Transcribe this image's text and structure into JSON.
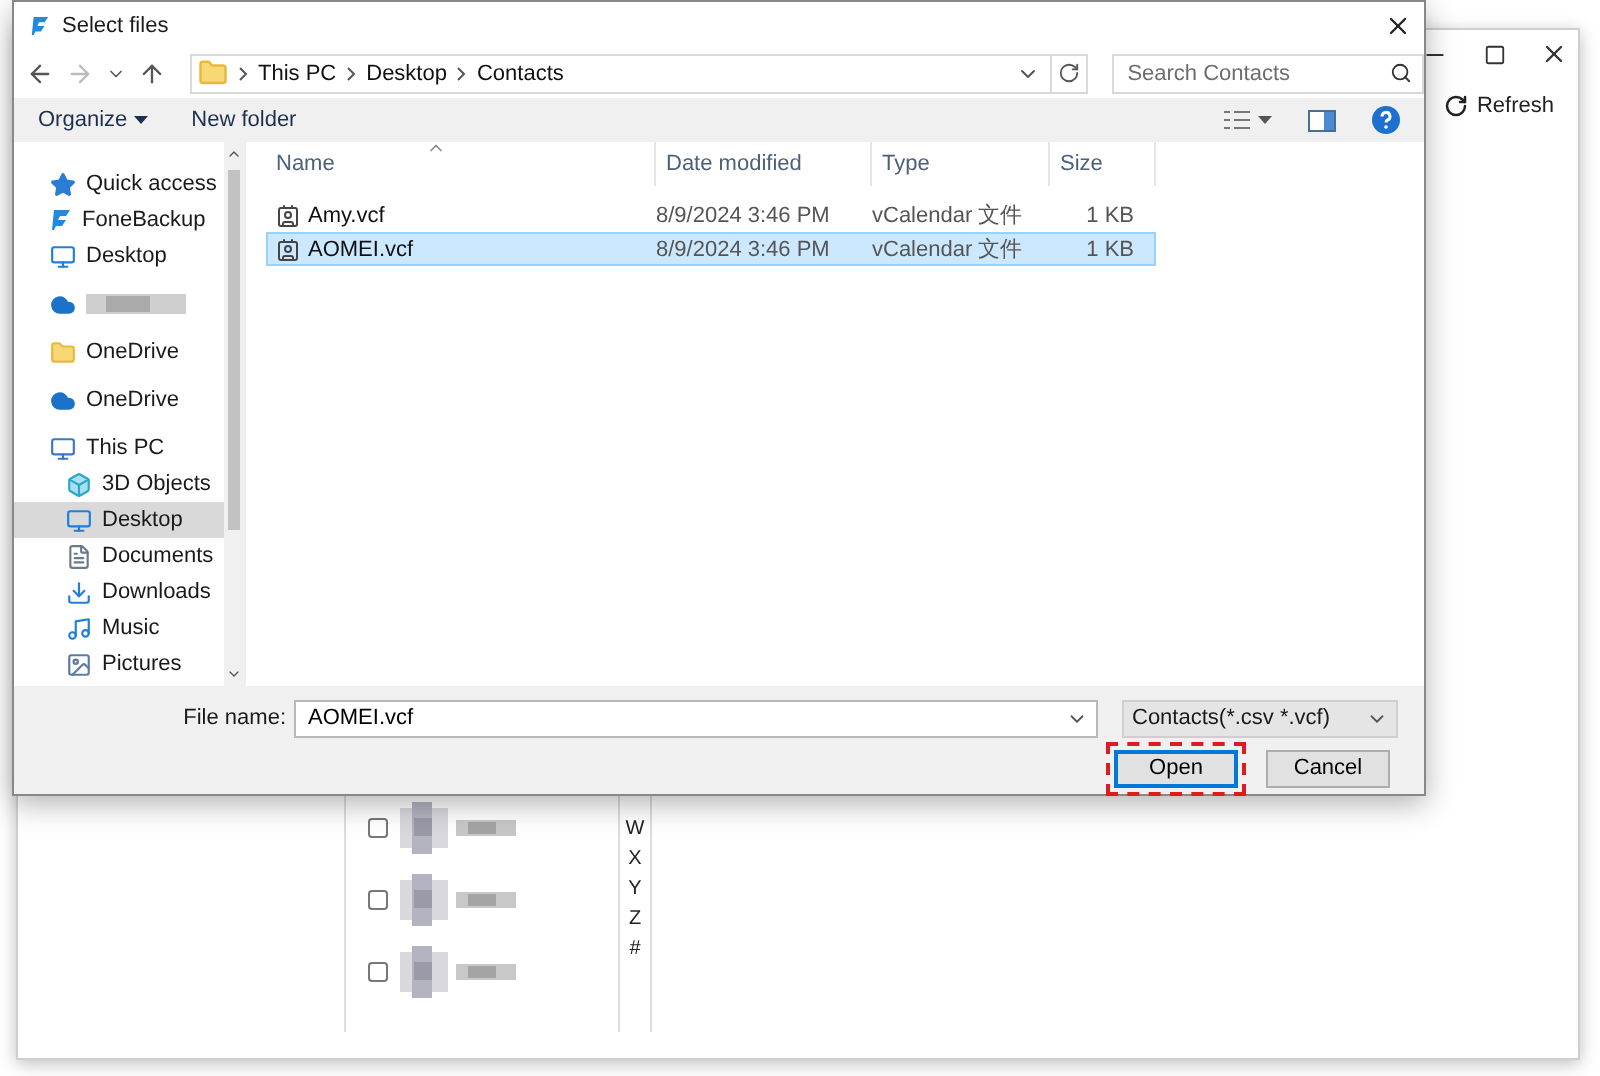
{
  "dialog": {
    "title": "Select files",
    "nav": {
      "path": [
        "This PC",
        "Desktop",
        "Contacts"
      ],
      "search_placeholder": "Search Contacts"
    },
    "toolbar": {
      "organize": "Organize",
      "new_folder": "New folder"
    },
    "sidebar": [
      {
        "items": [
          {
            "kind": "star",
            "label": "Quick access",
            "selected": false
          },
          {
            "kind": "app",
            "label": "FoneBackup",
            "selected": false
          },
          {
            "kind": "desktop",
            "label": "Desktop",
            "selected": false
          }
        ]
      },
      {
        "items": [
          {
            "kind": "redacted",
            "selected": false
          }
        ]
      },
      {
        "items": [
          {
            "kind": "folder",
            "label": "OneDrive",
            "selected": false
          }
        ]
      },
      {
        "items": [
          {
            "kind": "cloud",
            "label": "OneDrive",
            "selected": false
          }
        ]
      },
      {
        "items": [
          {
            "kind": "pc",
            "label": "This PC",
            "selected": false,
            "children": [
              {
                "kind": "cube",
                "label": "3D Objects",
                "selected": false
              },
              {
                "kind": "desktop",
                "label": "Desktop",
                "selected": true
              },
              {
                "kind": "document",
                "label": "Documents",
                "selected": false
              },
              {
                "kind": "download",
                "label": "Downloads",
                "selected": false
              },
              {
                "kind": "music",
                "label": "Music",
                "selected": false
              },
              {
                "kind": "image",
                "label": "Pictures",
                "selected": false
              }
            ]
          }
        ]
      }
    ],
    "columns": [
      "Name",
      "Date modified",
      "Type",
      "Size"
    ],
    "files": [
      {
        "name": "Amy.vcf",
        "date": "8/9/2024 3:46 PM",
        "type": "vCalendar 文件",
        "size": "1 KB",
        "selected": false
      },
      {
        "name": "AOMEI.vcf",
        "date": "8/9/2024 3:46 PM",
        "type": "vCalendar 文件",
        "size": "1 KB",
        "selected": true
      }
    ],
    "footer": {
      "file_name_label": "File name:",
      "file_name": "AOMEI.vcf",
      "filter": "Contacts(*.csv *.vcf)",
      "buttons": [
        {
          "label": "Open",
          "kind": "primary",
          "highlighted": true
        },
        {
          "label": "Cancel",
          "kind": "normal",
          "highlighted": false
        }
      ]
    }
  },
  "app": {
    "refresh": "Refresh",
    "index_letters": [
      "W",
      "X",
      "Y",
      "Z",
      "#"
    ],
    "contacts": [
      {
        "checked": false
      },
      {
        "checked": false
      },
      {
        "checked": false
      }
    ]
  }
}
